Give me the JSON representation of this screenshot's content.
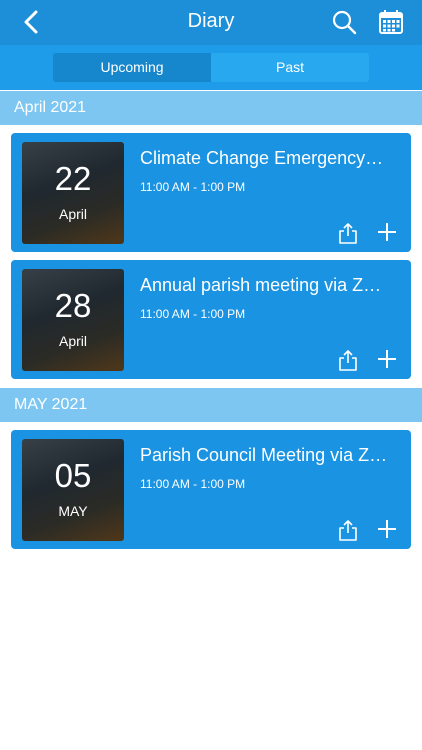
{
  "header": {
    "title": "Diary",
    "back_icon": "chevron-left-icon",
    "search_icon": "search-icon",
    "calendar_icon": "calendar-icon"
  },
  "segments": {
    "upcoming": "Upcoming",
    "past": "Past",
    "selected": "Upcoming"
  },
  "groups": [
    {
      "month": "April 2021",
      "events": [
        {
          "day": "22",
          "month": "April",
          "title": "Climate Change Emergency…",
          "time": "11:00 AM - 1:00 PM"
        },
        {
          "day": "28",
          "month": "April",
          "title": "Annual parish meeting via Z…",
          "time": "11:00 AM - 1:00 PM"
        }
      ]
    },
    {
      "month": "MAY 2021",
      "events": [
        {
          "day": "05",
          "month": "MAY",
          "title": "Parish Council Meeting via Z…",
          "time": "11:00 AM - 1:00 PM"
        }
      ]
    }
  ],
  "colors": {
    "header": "#1d8fd8",
    "card": "#1a93e2",
    "month_bar": "#7cc6f1"
  }
}
